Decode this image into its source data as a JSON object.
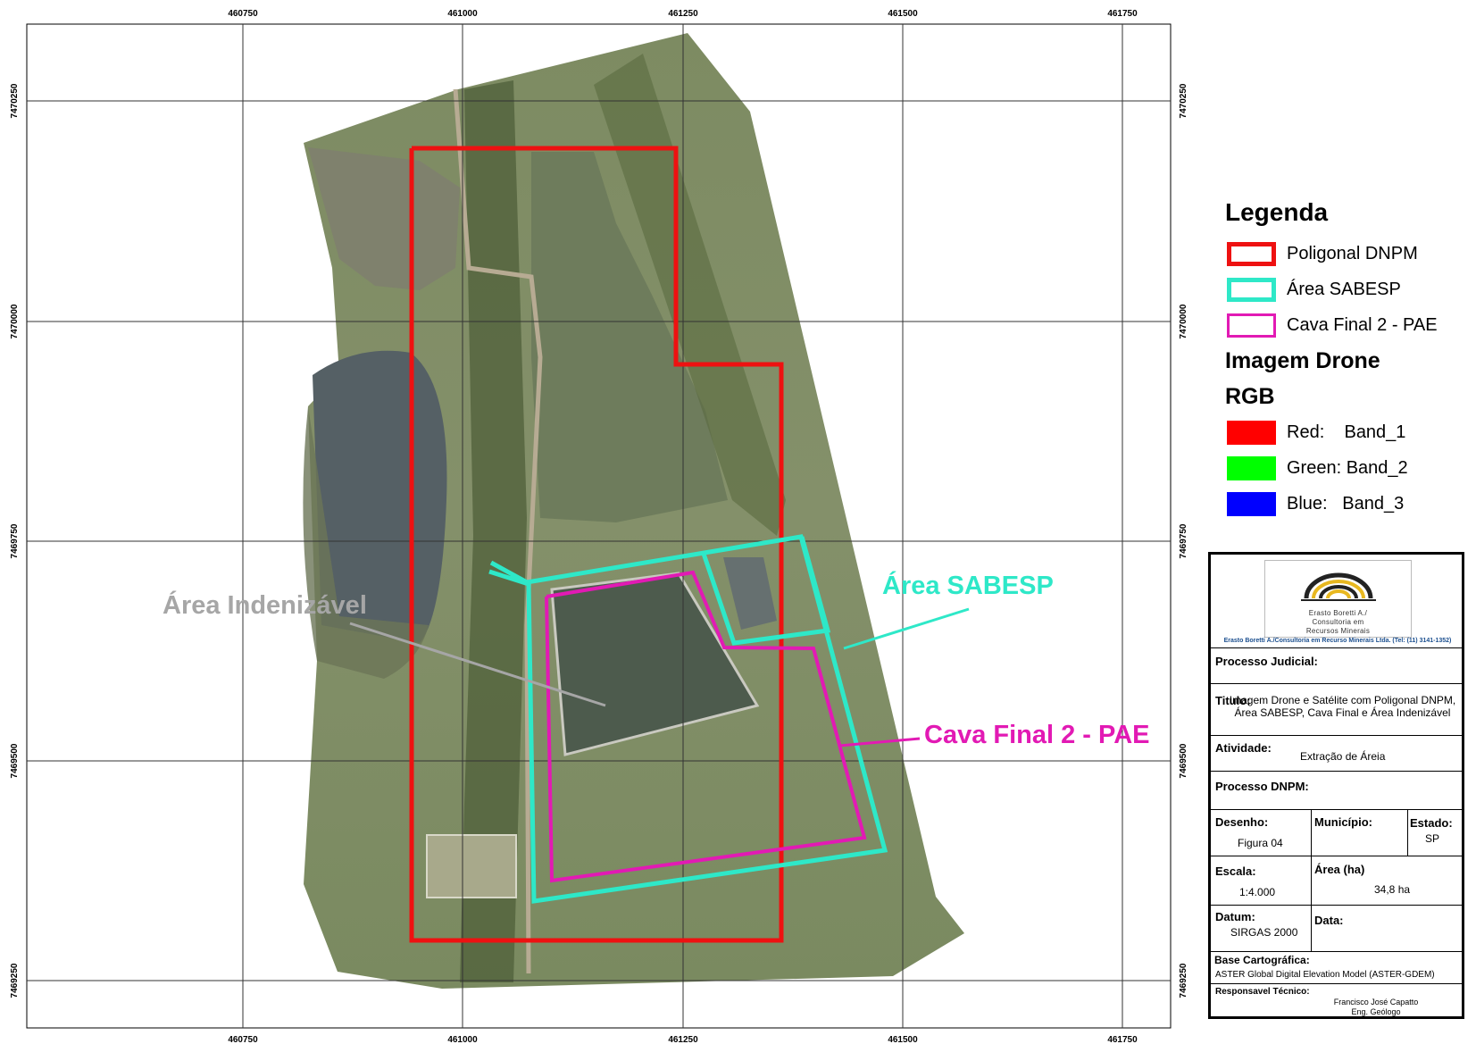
{
  "map": {
    "x_ticks": [
      "460750",
      "461000",
      "461250",
      "461500",
      "461750"
    ],
    "y_ticks": [
      "7470250",
      "7470000",
      "7469750",
      "7469500",
      "7469250"
    ],
    "labels": {
      "area_indenizavel": "Área Indenizável",
      "area_sabesp": "Área SABESP",
      "cava_final": "Cava Final 2 - PAE"
    },
    "colors": {
      "poligonal_dnpm": "#ee1111",
      "area_sabesp": "#2ee8c8",
      "cava_final": "#e21ab4",
      "label_indenizavel": "#a6a6a6",
      "grid": "#000000"
    }
  },
  "legend": {
    "title": "Legenda",
    "items": [
      {
        "label": "Poligonal DNPM",
        "color": "#ee1111"
      },
      {
        "label": "Área SABESP",
        "color": "#2ee8c8"
      },
      {
        "label": "Cava Final 2 - PAE",
        "color": "#e21ab4"
      }
    ],
    "image_title": "Imagem Drone",
    "rgb_title": "RGB",
    "bands": [
      {
        "label": "Red:    Band_1",
        "color": "#ff0000"
      },
      {
        "label": "Green: Band_2",
        "color": "#00ff00"
      },
      {
        "label": "Blue:   Band_3",
        "color": "#0000ff"
      }
    ]
  },
  "title_block": {
    "logo_lines": [
      "Erasto Boretti A./",
      "Consultoria em",
      "Recursos Minerais"
    ],
    "company": "Erasto Boretti A./Consultoria em Recurso Minerais Ltda. (Tel: (11) 3141-1352)",
    "processo_judicial_label": "Processo Judicial:",
    "titulo_label": "Titulo:",
    "titulo_value": "Imagem Drone e Satélite com Poligonal DNPM, Área SABESP, Cava Final e Área Indenizável",
    "atividade_label": "Atividade:",
    "atividade_value": "Extração de Áreia",
    "processo_dnpm_label": "Processo DNPM:",
    "desenho_label": "Desenho:",
    "desenho_value": "Figura 04",
    "municipio_label": "Município:",
    "estado_label": "Estado:",
    "estado_value": "SP",
    "escala_label": "Escala:",
    "escala_value": "1:4.000",
    "area_label": "Área (ha)",
    "area_value": "34,8 ha",
    "datum_label": "Datum:",
    "datum_value": "SIRGAS 2000",
    "data_label": "Data:",
    "base_label": "Base Cartográfica:",
    "base_value": "ASTER Global Digital Elevation Model (ASTER-GDEM)",
    "responsavel_label": "Responsavel Técnico:",
    "responsavel_name": "Francisco José Capatto",
    "responsavel_title": "Eng. Geólogo"
  }
}
